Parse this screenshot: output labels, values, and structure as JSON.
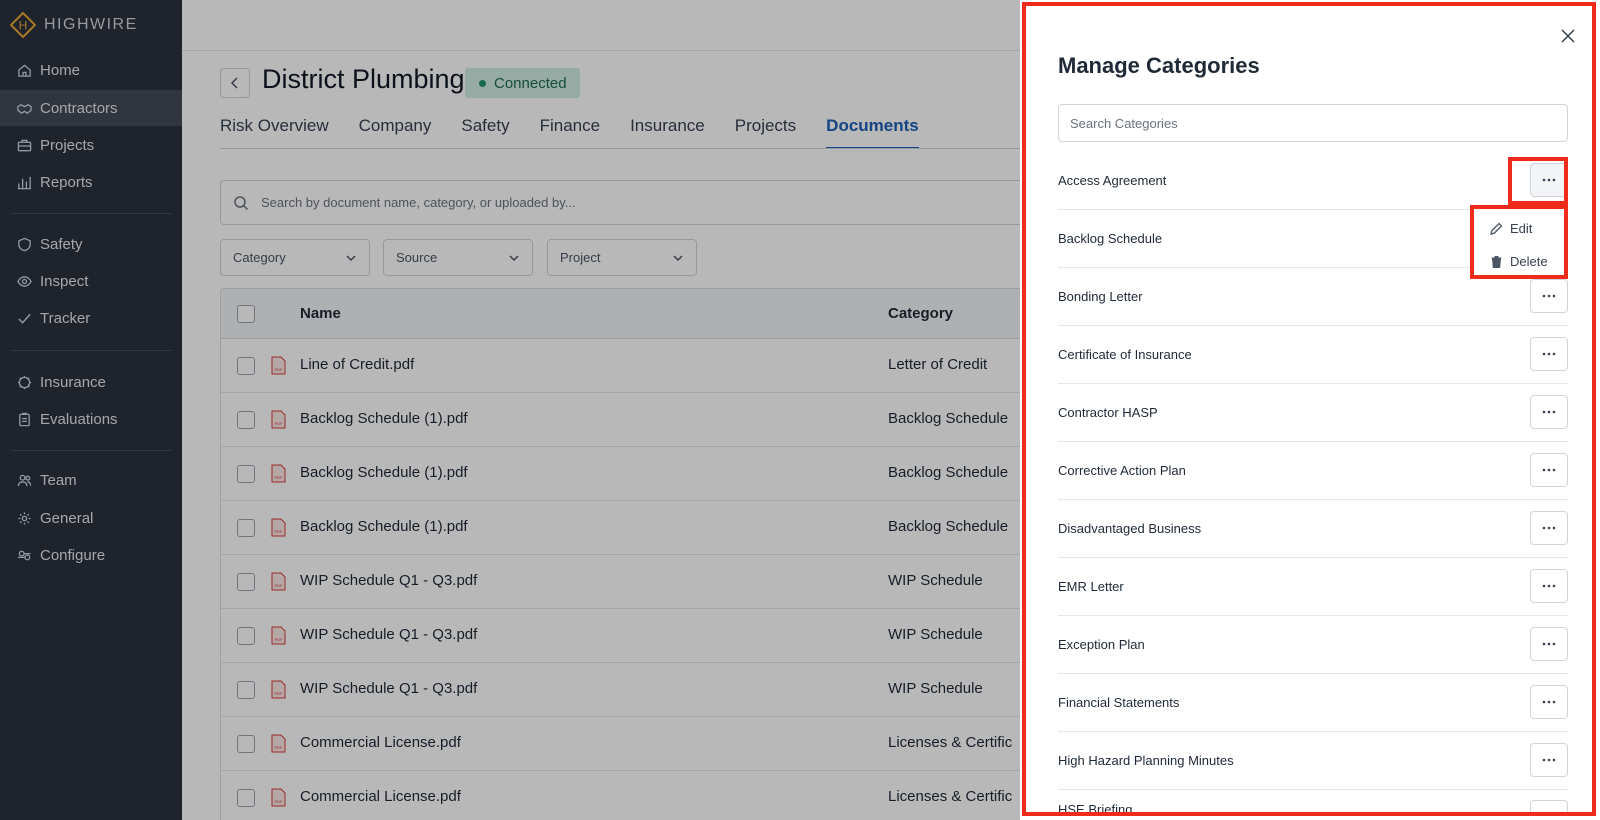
{
  "brand": {
    "name": "HIGHWIRE",
    "logo_letter": "H",
    "accent": "#e8a838"
  },
  "sidebar": {
    "items": [
      {
        "label": "Home",
        "icon": "home-icon"
      },
      {
        "label": "Contractors",
        "icon": "handshake-icon",
        "active": true
      },
      {
        "label": "Projects",
        "icon": "briefcase-icon"
      },
      {
        "label": "Reports",
        "icon": "bar-chart-icon"
      },
      {
        "label": "Safety",
        "icon": "shield-icon"
      },
      {
        "label": "Inspect",
        "icon": "eye-icon"
      },
      {
        "label": "Tracker",
        "icon": "check-icon"
      },
      {
        "label": "Insurance",
        "icon": "badge-icon"
      },
      {
        "label": "Evaluations",
        "icon": "clipboard-icon"
      },
      {
        "label": "Team",
        "icon": "users-icon"
      },
      {
        "label": "General",
        "icon": "gear-icon"
      },
      {
        "label": "Configure",
        "icon": "configure-icon"
      }
    ]
  },
  "page": {
    "title": "District Plumbing",
    "status": "Connected",
    "tabs": [
      "Risk Overview",
      "Company",
      "Safety",
      "Finance",
      "Insurance",
      "Projects",
      "Documents"
    ],
    "active_tab": "Documents",
    "search_placeholder": "Search by document name, category, or uploaded by...",
    "filters": [
      "Category",
      "Source",
      "Project"
    ]
  },
  "table": {
    "columns": [
      "Name",
      "Category"
    ],
    "rows": [
      {
        "name": "Line of Credit.pdf",
        "category": "Letter of Credit"
      },
      {
        "name": "Backlog Schedule (1).pdf",
        "category": "Backlog Schedule"
      },
      {
        "name": "Backlog Schedule (1).pdf",
        "category": "Backlog Schedule"
      },
      {
        "name": "Backlog Schedule (1).pdf",
        "category": "Backlog Schedule"
      },
      {
        "name": "WIP Schedule Q1 - Q3.pdf",
        "category": "WIP Schedule"
      },
      {
        "name": "WIP Schedule Q1 - Q3.pdf",
        "category": "WIP Schedule"
      },
      {
        "name": "WIP Schedule Q1 - Q3.pdf",
        "category": "WIP Schedule"
      },
      {
        "name": "Commercial License.pdf",
        "category": "Licenses & Certific"
      },
      {
        "name": "Commercial License.pdf",
        "category": "Licenses & Certific"
      }
    ]
  },
  "modal": {
    "title": "Manage Categories",
    "search_placeholder": "Search Categories",
    "categories": [
      "Access Agreement",
      "Backlog Schedule",
      "Bonding Letter",
      "Certificate of Insurance",
      "Contractor HASP",
      "Corrective Action Plan",
      "Disadvantaged Business",
      "EMR Letter",
      "Exception Plan",
      "Financial Statements",
      "High Hazard Planning Minutes",
      "HSE Briefing"
    ],
    "menu": {
      "edit": "Edit",
      "delete": "Delete"
    }
  },
  "colors": {
    "highlight": "#ef2b1c",
    "link": "#1d5fb8",
    "sidebar": "#2b313c"
  }
}
